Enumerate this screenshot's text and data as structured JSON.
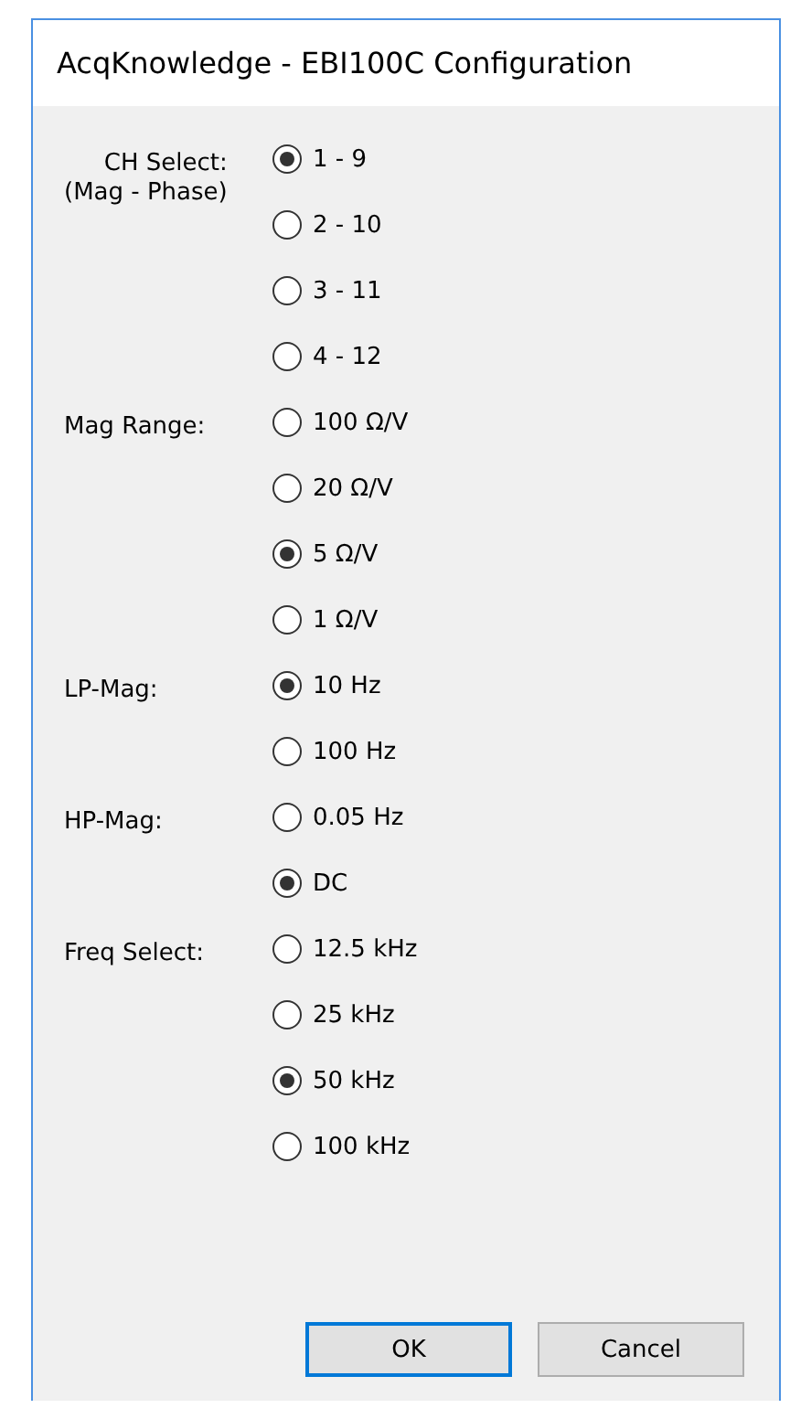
{
  "window": {
    "title": "AcqKnowledge - EBI100C Configuration"
  },
  "groups": [
    {
      "label_lines": [
        "CH Select:",
        "(Mag - Phase)"
      ],
      "options": [
        {
          "label": "1 - 9",
          "selected": true
        },
        {
          "label": "2 - 10",
          "selected": false
        },
        {
          "label": "3 - 11",
          "selected": false
        },
        {
          "label": "4 - 12",
          "selected": false
        }
      ]
    },
    {
      "label_lines": [
        "Mag Range:"
      ],
      "options": [
        {
          "label": "100 Ω/V",
          "selected": false
        },
        {
          "label": "20 Ω/V",
          "selected": false
        },
        {
          "label": "5 Ω/V",
          "selected": true
        },
        {
          "label": "1 Ω/V",
          "selected": false
        }
      ]
    },
    {
      "label_lines": [
        "LP-Mag:"
      ],
      "options": [
        {
          "label": "10 Hz",
          "selected": true
        },
        {
          "label": "100 Hz",
          "selected": false
        }
      ]
    },
    {
      "label_lines": [
        "HP-Mag:"
      ],
      "options": [
        {
          "label": "0.05 Hz",
          "selected": false
        },
        {
          "label": "DC",
          "selected": true
        }
      ]
    },
    {
      "label_lines": [
        "Freq Select:"
      ],
      "options": [
        {
          "label": "12.5 kHz",
          "selected": false
        },
        {
          "label": "25 kHz",
          "selected": false
        },
        {
          "label": "50 kHz",
          "selected": true
        },
        {
          "label": "100 kHz",
          "selected": false
        }
      ]
    }
  ],
  "buttons": [
    {
      "label": "OK",
      "default": true
    },
    {
      "label": "Cancel",
      "default": false
    }
  ]
}
